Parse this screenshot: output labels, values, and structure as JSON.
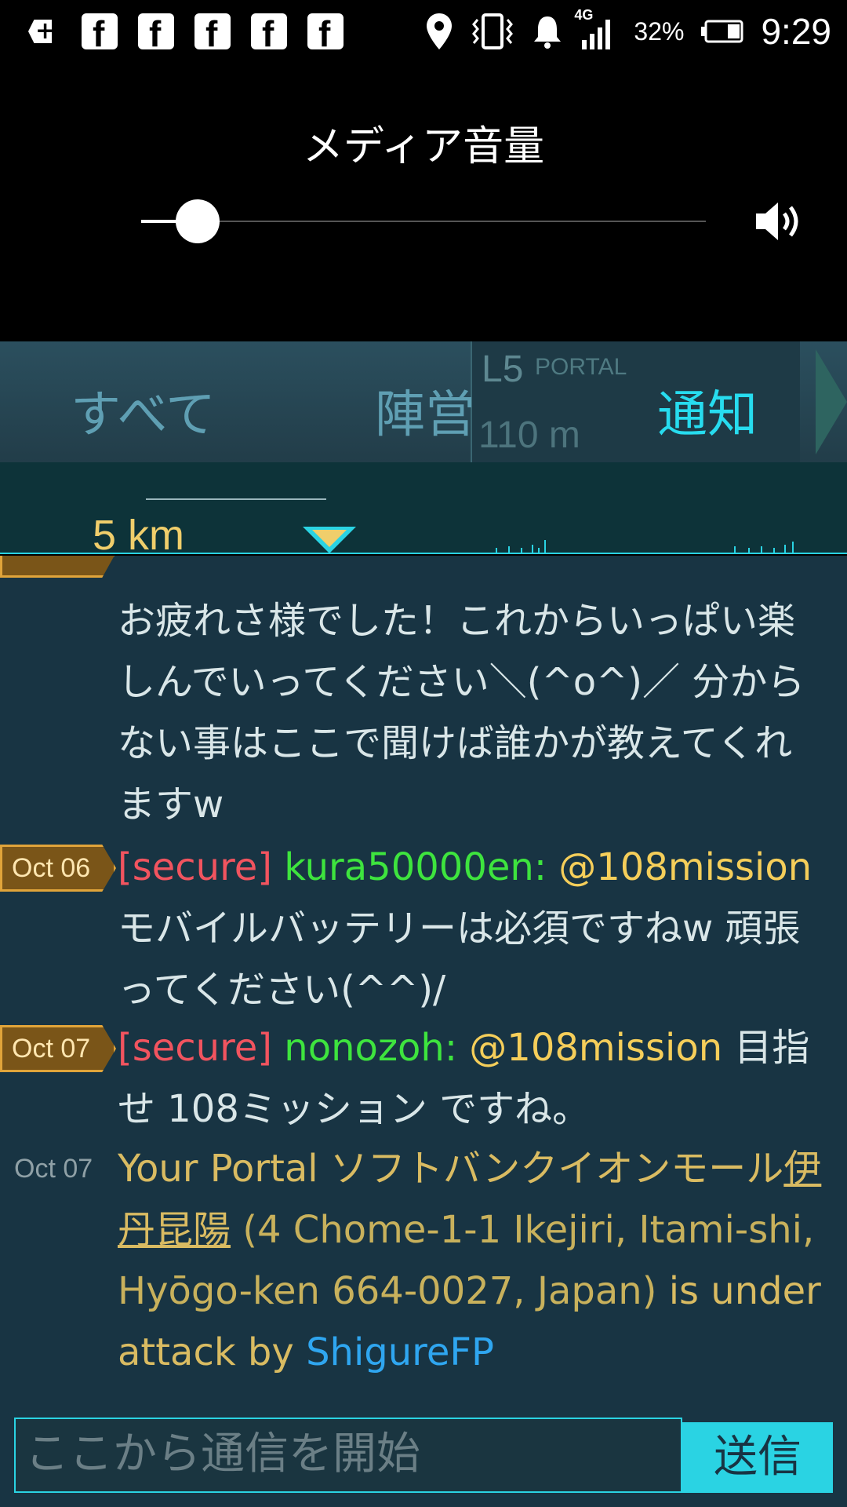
{
  "status_bar": {
    "battery_percent": "32%",
    "time": "9:29",
    "network": "4G",
    "left_icons": [
      "add-icon",
      "facebook-icon",
      "facebook-icon",
      "facebook-icon",
      "facebook-icon",
      "facebook-icon"
    ],
    "right_icons": [
      "location-icon",
      "vibrate-icon",
      "bell-icon",
      "signal-icon",
      "battery-icon"
    ],
    "fb_letter": "f",
    "plus": "+"
  },
  "volume": {
    "title": "メディア音量",
    "level": 0.1
  },
  "tabs": {
    "all": "すべて",
    "faction": "陣営",
    "alerts": "通知",
    "active": "alerts"
  },
  "portal_card": {
    "level": "L5",
    "label": "PORTAL",
    "distance": "110 m"
  },
  "range": {
    "label": "5 km"
  },
  "messages": [
    {
      "date": "",
      "text": "お疲れさ様でした！これからいっぱい楽しんでいってください＼(^o^)／ 分からない事はここで聞けば誰かが教えてくれますw"
    },
    {
      "date": "Oct 06",
      "tag": "[secure]",
      "author": "kura50000en:",
      "mention": "@108mission",
      "text": "モバイルバッテリーは必須ですねw 頑張ってください(^^)/"
    },
    {
      "date": "Oct 07",
      "tag": "[secure]",
      "author": "nonozoh:",
      "mention": "@108mission",
      "text": "目指せ 108ミッション ですね。"
    },
    {
      "date": "Oct 07",
      "prefix": "Your Portal",
      "portal_name": "ソフトバンクイオンモール伊丹昆陽",
      "address": "(4 Chome-1-1 Ikejiri, Itami-shi, Hyōgo-ken 664-0027, Japan)",
      "action": "is under attack by",
      "attacker": "ShigureFP"
    }
  ],
  "input": {
    "placeholder": "ここから通信を開始",
    "send_label": "送信"
  },
  "colors": {
    "accent": "#2ad3e3",
    "secure": "#f1545f",
    "agent": "#3ee43e",
    "mention": "#f5ce5a",
    "attacker": "#2fa6f0",
    "chat_bg": "#183443"
  }
}
